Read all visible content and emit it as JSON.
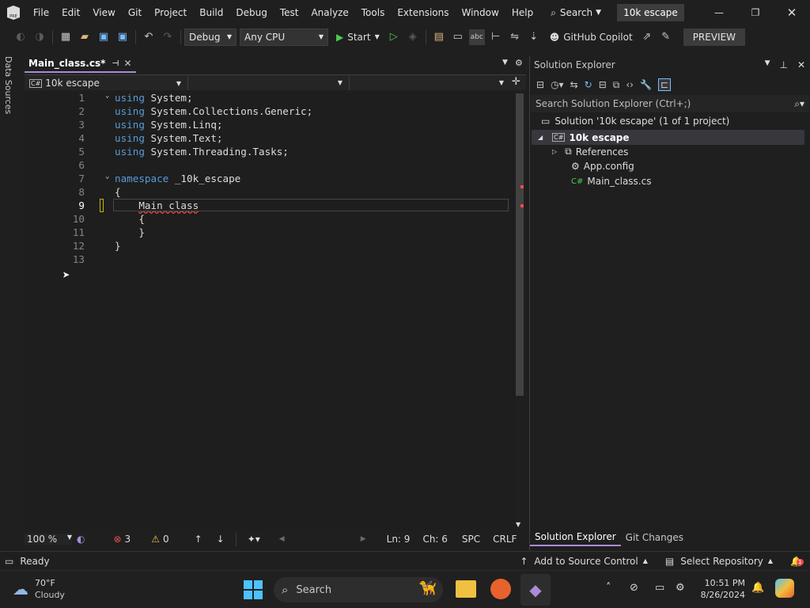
{
  "menu": [
    "File",
    "Edit",
    "View",
    "Git",
    "Project",
    "Build",
    "Debug",
    "Test",
    "Analyze",
    "Tools",
    "Extensions",
    "Window",
    "Help"
  ],
  "search_label": "Search",
  "solution_name_badge": "10k escape",
  "toolbar": {
    "config": "Debug",
    "platform": "Any CPU",
    "start_label": "Start",
    "copilot_label": "GitHub Copilot",
    "preview_label": "PREVIEW"
  },
  "left_strip_label": "Data Sources",
  "editor": {
    "tab_label": "Main_class.cs*",
    "nav_project": "10k escape",
    "lines": [
      {
        "n": "1",
        "text": "using System;"
      },
      {
        "n": "2",
        "text": "using System.Collections.Generic;"
      },
      {
        "n": "3",
        "text": "using System.Linq;"
      },
      {
        "n": "4",
        "text": "using System.Text;"
      },
      {
        "n": "5",
        "text": "using System.Threading.Tasks;"
      },
      {
        "n": "6",
        "text": ""
      },
      {
        "n": "7",
        "text": "namespace _10k_escape"
      },
      {
        "n": "8",
        "text": "{"
      },
      {
        "n": "9",
        "text": "    Main_class"
      },
      {
        "n": "10",
        "text": "    {"
      },
      {
        "n": "11",
        "text": "    }"
      },
      {
        "n": "12",
        "text": "}"
      },
      {
        "n": "13",
        "text": ""
      }
    ],
    "status": {
      "zoom": "100 %",
      "errors": "3",
      "warnings": "0",
      "line": "Ln: 9",
      "col": "Ch: 6",
      "spc": "SPC",
      "eol": "CRLF"
    }
  },
  "solution_explorer": {
    "title": "Solution Explorer",
    "search_placeholder": "Search Solution Explorer (Ctrl+;)",
    "solution_label": "Solution '10k escape' (1 of 1 project)",
    "project_label": "10k escape",
    "items": [
      "References",
      "App.config",
      "Main_class.cs"
    ],
    "bottom_tabs": [
      "Solution Explorer",
      "Git Changes"
    ]
  },
  "statusbar": {
    "ready": "Ready",
    "source_control": "Add to Source Control",
    "repository": "Select Repository",
    "notif_count": "1"
  },
  "taskbar": {
    "weather_temp": "70°F",
    "weather_desc": "Cloudy",
    "search_label": "Search",
    "time": "10:51 PM",
    "date": "8/26/2024"
  }
}
